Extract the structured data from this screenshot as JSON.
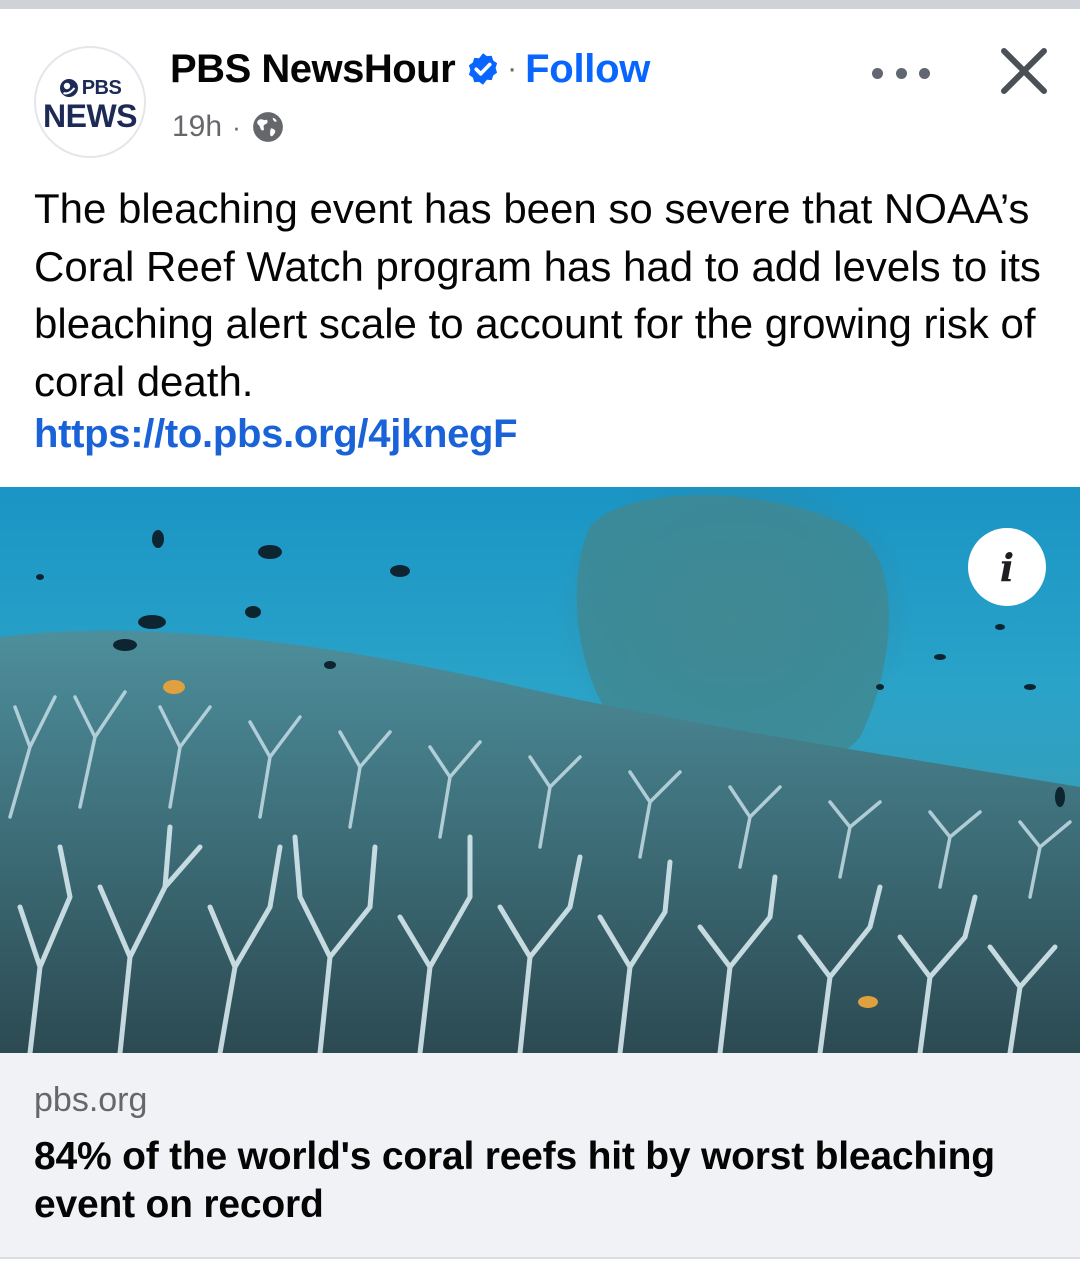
{
  "post": {
    "author": {
      "name": "PBS NewsHour",
      "avatar_text_top": "PBS",
      "avatar_text_bottom": "NEWS",
      "verified_icon": "verified-badge-icon",
      "follow_label": "Follow",
      "separator": "·"
    },
    "meta": {
      "time": "19h",
      "separator": "·",
      "audience_icon": "globe-icon"
    },
    "text": "The bleaching event has been so severe that NOAA’s Coral Reef Watch program has had to add levels to its bleaching alert scale to account for the growing risk of coral death.",
    "link": "https://to.pbs.org/4jknegF",
    "image": {
      "info_label": "i",
      "info_icon": "info-icon"
    },
    "link_card": {
      "domain": "pbs.org",
      "headline": "84% of the world's coral reefs hit by worst bleaching event on record"
    },
    "controls": {
      "more_icon": "more-options-icon",
      "close_icon": "close-icon"
    }
  },
  "colors": {
    "accent": "#0866ff",
    "link": "#1a62d8",
    "text": "#050505",
    "secondary_text": "#65676b",
    "card_bg": "#f0f2f5"
  }
}
